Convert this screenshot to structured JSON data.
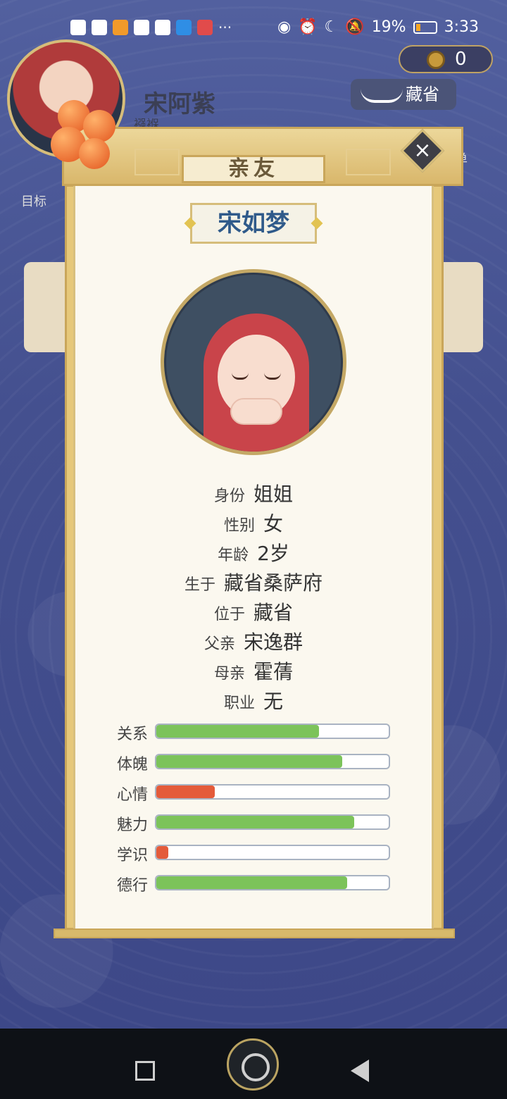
{
  "statusbar": {
    "battery": "19%",
    "time": "3:33",
    "more": "···"
  },
  "hud": {
    "player_name": "宋阿紫",
    "player_sub": "襁褓",
    "coins": "0",
    "region": "藏省",
    "menu": "菜单",
    "goal": "目标"
  },
  "panel": {
    "title": "亲友",
    "close": "×",
    "name": "宋如梦",
    "info": [
      {
        "label": "身份",
        "value": "姐姐"
      },
      {
        "label": "性别",
        "value": "女"
      },
      {
        "label": "年龄",
        "value": "2岁"
      },
      {
        "label": "生于",
        "value": "藏省桑萨府"
      },
      {
        "label": "位于",
        "value": "藏省"
      },
      {
        "label": "父亲",
        "value": "宋逸群"
      },
      {
        "label": "母亲",
        "value": "霍蒨"
      },
      {
        "label": "职业",
        "value": "无"
      }
    ],
    "stats": [
      {
        "label": "关系",
        "value": 0.7,
        "color": "#7cc35a"
      },
      {
        "label": "体魄",
        "value": 0.8,
        "color": "#7cc35a"
      },
      {
        "label": "心情",
        "value": 0.25,
        "color": "#e45b3a"
      },
      {
        "label": "魅力",
        "value": 0.85,
        "color": "#7cc35a"
      },
      {
        "label": "学识",
        "value": 0.05,
        "color": "#e45b3a"
      },
      {
        "label": "德行",
        "value": 0.82,
        "color": "#7cc35a"
      }
    ]
  }
}
